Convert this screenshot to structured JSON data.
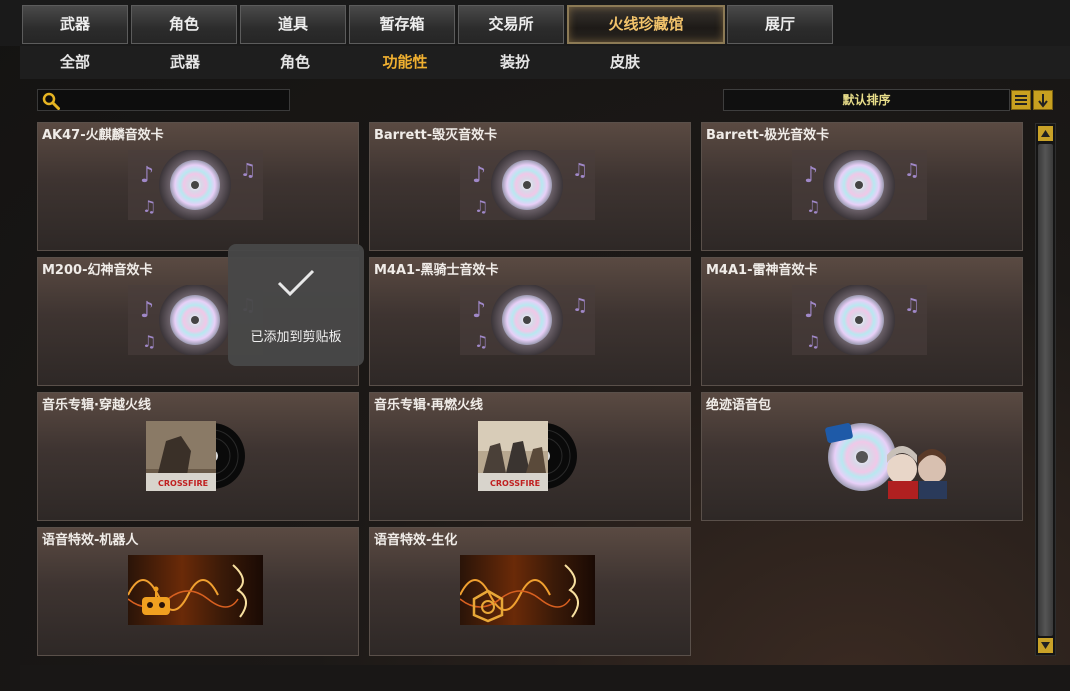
{
  "tabs": [
    {
      "label": "武器"
    },
    {
      "label": "角色"
    },
    {
      "label": "道具"
    },
    {
      "label": "暂存箱"
    },
    {
      "label": "交易所"
    },
    {
      "label": "火线珍藏馆",
      "active": true
    },
    {
      "label": "展厅"
    }
  ],
  "subtabs": [
    {
      "label": "全部"
    },
    {
      "label": "武器"
    },
    {
      "label": "角色"
    },
    {
      "label": "功能性",
      "active": true
    },
    {
      "label": "装扮"
    },
    {
      "label": "皮肤"
    }
  ],
  "search": {
    "placeholder": "",
    "icon": "search-icon"
  },
  "sort": {
    "label": "默认排序",
    "list_icon": "list-icon",
    "order_icon": "arrow-down-icon"
  },
  "items": [
    {
      "name": "AK47-火麒麟音效卡",
      "kind": "sound-card"
    },
    {
      "name": "Barrett-毁灭音效卡",
      "kind": "sound-card"
    },
    {
      "name": "Barrett-极光音效卡",
      "kind": "sound-card"
    },
    {
      "name": "M200-幻神音效卡",
      "kind": "sound-card"
    },
    {
      "name": "M4A1-黑骑士音效卡",
      "kind": "sound-card"
    },
    {
      "name": "M4A1-雷神音效卡",
      "kind": "sound-card"
    },
    {
      "name": "音乐专辑·穿越火线",
      "kind": "album",
      "logo_text": "CROSSFIRE"
    },
    {
      "name": "音乐专辑·再燃火线",
      "kind": "album",
      "logo_text": "CROSSFIRE"
    },
    {
      "name": "绝迹语音包",
      "kind": "voice-pack"
    },
    {
      "name": "语音特效-机器人",
      "kind": "voice-fx-robot"
    },
    {
      "name": "语音特效-生化",
      "kind": "voice-fx-bio"
    }
  ],
  "toast": {
    "message": "已添加到剪贴板"
  },
  "colors": {
    "accent": "#f0b030",
    "active_tab_text": "#f2c36b",
    "sort_text": "#e8dd8a"
  }
}
